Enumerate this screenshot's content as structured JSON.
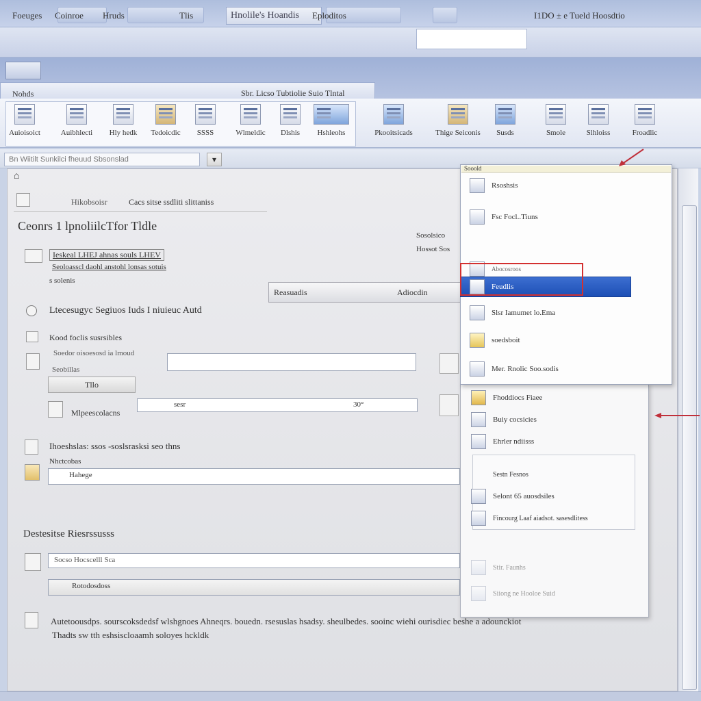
{
  "titlebar": {
    "main_title": "Hnolile's Hoandis"
  },
  "menubar": {
    "items": [
      "Foeuges",
      "Coinroe",
      "Hruds",
      "Tlis",
      "Eploditos"
    ],
    "right_text": "I1DO ± e Tueld Hoosdtio"
  },
  "tabstrip": {
    "left_label": "Nohds",
    "right_label": "Sbr. Licso Tubtiolie Suio Tlntal"
  },
  "ribbon": {
    "left_buttons": [
      "Auioisoict",
      "Auibhlecti",
      "Hly hedk",
      "Tedoicdic",
      "SSSS",
      "Wlmeldic",
      "Dlshis",
      "Hshleohs"
    ],
    "right_buttons": [
      "Pkooitsicads",
      "Thige Seiconis",
      "Susds",
      "Smole",
      "Slhloiss",
      "Froadlic"
    ]
  },
  "address": {
    "value": "Bn Wiitilt Sunkilci fheuud Sbsonslad"
  },
  "main": {
    "toolbar_text": "Hikobsoisr",
    "toolbar_desc": "Cacs sitse ssdliti slittaniss",
    "section_title": "Ceonrs 1 lpnoliilcTfor Tldle",
    "right_label_1": "Sosolsico",
    "right_label_2": "Hossot Sos",
    "link_line_1": "Ieskeal LHEJ ahnas souls LHEV",
    "link_line_2": "Seoloasscl daohl anstohl lonsas sotuis",
    "small_label": "s solenis",
    "inline_toolbar": [
      "Reasuadis",
      "Adiocdin"
    ],
    "row_1": "Ltecesugyc Segiuos Iuds I niuieuc Autd",
    "row_2": "Kood foclis susrsibles",
    "row_2_sub": "Soedor oisoesosd ia lmoud",
    "row_2_sub2": "Seobillas",
    "button_ttlo": "Tllo",
    "row_3_label": "Mlpeescolacns",
    "slider_left": "sesr",
    "slider_right": "30°",
    "row_4": "Ihoeshslas: ssos -soslsrasksi seo thns",
    "row_4_sub": "Nhctcobas",
    "row_4_field": "Hahege",
    "section_2_title": "Destesitse Riesrssusss",
    "field_a": "Socso Hocscelll Sca",
    "field_b": "Rotodosdoss",
    "footer_line_1": "Autetoousdps. sourscoksdedsf wlshgnoes Ahneqrs. bouedn. rsesuslas hsadsy. sheulbedes. sooinc wiehi ourisdiec beshe a adounckiot",
    "footer_line_2": "Thadts sw tth eshsiscloaamh soloyes hckldk"
  },
  "dropdown": {
    "header": "Sooold",
    "items_top": [
      "Rsoshsis",
      "Fsc Focl..Tiuns",
      "Abocosroos"
    ],
    "selected": "Feudlis",
    "items_mid": [
      "Slsr Iamumet lo.Ema",
      "soedsboit",
      "Mer. Rnolic Soo.sodis"
    ],
    "items_bottom": [
      "Fhoddiocs Fiaee",
      "Buiy cocsicies",
      "Ehrler ndiisss",
      "Sestn Fesnos",
      "Selont 65 auosdsiles",
      "Fincourg Laaf aiadsot. sasesdlitess",
      "Stir. Faunhs",
      "Siiong ne Hooloe Suid"
    ]
  },
  "colors": {
    "accent": "#2a5cc2",
    "highlight_border": "#d33030"
  }
}
